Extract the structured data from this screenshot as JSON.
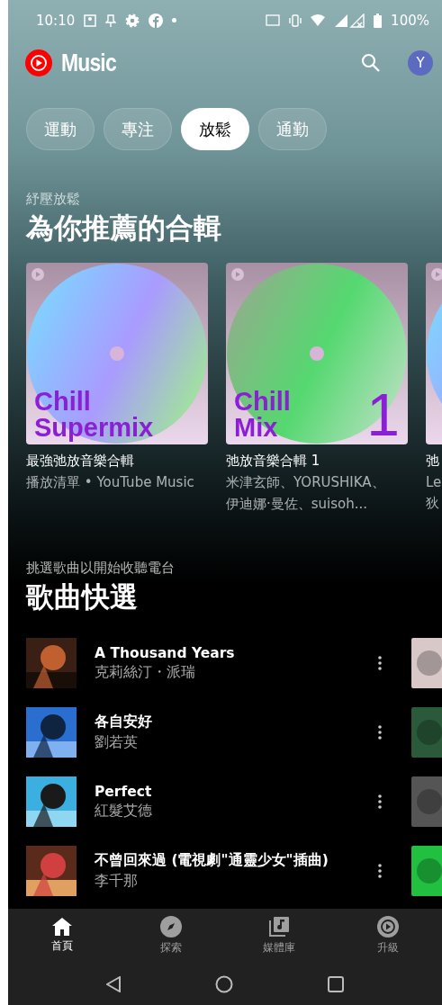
{
  "status_bar": {
    "time": "10:10",
    "battery": "100%"
  },
  "header": {
    "logo": "Music",
    "avatar": "Y"
  },
  "chips": [
    {
      "label": "運動",
      "selected": false
    },
    {
      "label": "專注",
      "selected": false
    },
    {
      "label": "放鬆",
      "selected": true
    },
    {
      "label": "通勤",
      "selected": false
    }
  ],
  "mixes": {
    "subtitle": "紓壓放鬆",
    "title": "為你推薦的合輯",
    "cards": [
      {
        "cover_lines": [
          "Chill",
          "Supermix"
        ],
        "title": "最強弛放音樂合輯",
        "subtitle_lines": [
          "播放清單 • YouTube Music"
        ]
      },
      {
        "cover_lines": [
          "Chill",
          "Mix"
        ],
        "cover_number": "1",
        "title": "弛放音樂合輯 1",
        "subtitle_lines": [
          "米津玄師、YORUSHIKA、",
          "伊迪娜·曼佐、suisoh..."
        ]
      },
      {
        "title": "弛",
        "subtitle_lines": [
          "Le",
          "狄"
        ]
      }
    ]
  },
  "quick_picks": {
    "subtitle": "挑選歌曲以開始收聽電台",
    "title": "歌曲快選",
    "songs": [
      {
        "title": "A Thousand Years",
        "artist": "克莉絲汀・派瑞"
      },
      {
        "title": "各自安好",
        "artist": "劉若英"
      },
      {
        "title": "Perfect",
        "artist": "紅髮艾德"
      },
      {
        "title": "不曾回來過 (電視劇\"通靈少女\"插曲)",
        "artist": "李千那"
      }
    ]
  },
  "bottom_nav": [
    {
      "kind": "home",
      "label": "首頁",
      "selected": true
    },
    {
      "kind": "explore",
      "label": "探索",
      "selected": false
    },
    {
      "kind": "library",
      "label": "媒體庫",
      "selected": false
    },
    {
      "kind": "upgrade",
      "label": "升級",
      "selected": false
    }
  ]
}
